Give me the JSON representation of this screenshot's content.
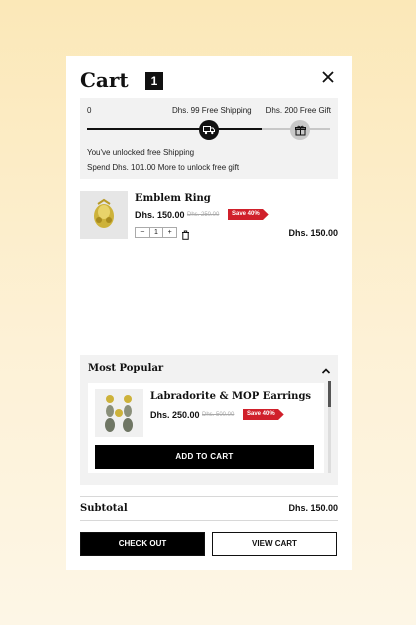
{
  "cart": {
    "title": "Cart",
    "count": "1"
  },
  "progress": {
    "start_label": "0",
    "shipping_label": "Dhs. 99 Free Shipping",
    "gift_label": "Dhs. 200 Free Gift",
    "fill_fraction": 0.72,
    "message_1": "You've unlocked free Shipping",
    "message_2": "Spend Dhs. 101.00 More to unlock free gift"
  },
  "items": [
    {
      "name": "Emblem Ring",
      "price": "Dhs. 150.00",
      "old_price": "Dhs. 250.00",
      "badge": "Save 40%",
      "quantity": "1",
      "line_total": "Dhs. 150.00"
    }
  ],
  "popular": {
    "title": "Most Popular",
    "product": {
      "name": "Labradorite & MOP Earrings",
      "price": "Dhs. 250.00",
      "old_price": "Dhs. 500.00",
      "badge": "Save 40%",
      "button": "ADD TO CART"
    }
  },
  "summary": {
    "subtotal_label": "Subtotal",
    "subtotal_value": "Dhs. 150.00"
  },
  "actions": {
    "checkout": "CHECK OUT",
    "view_cart": "VIEW CART"
  },
  "stepper": {
    "minus": "−",
    "plus": "+"
  },
  "colors": {
    "accent": "#d0202b",
    "primary": "#000000",
    "background": "#fbe8b8"
  }
}
